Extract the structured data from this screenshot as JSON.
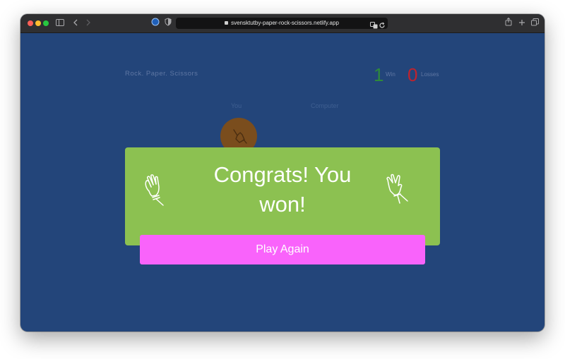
{
  "browser": {
    "url": "svensktutby-paper-rock-scissors.netlify.app",
    "icons": {
      "sidebar": "sidebar-icon",
      "back": "chevron-left-icon",
      "forward": "chevron-right-icon",
      "shield": "shield-icon",
      "translate": "translate-icon",
      "reload": "reload-icon",
      "share": "share-icon",
      "new_tab": "plus-icon",
      "tabs": "tabs-overview-icon"
    }
  },
  "game": {
    "title": "Rock. Paper. Scissors",
    "wins": {
      "value": "1",
      "label": "Win",
      "color": "#2f8a3a"
    },
    "losses": {
      "value": "0",
      "label": "Losses",
      "color": "#c0232d"
    },
    "player_label": "You",
    "computer_label": "Computer"
  },
  "result": {
    "message": "Congrats! You won!",
    "button_label": "Play Again",
    "card_color": "#8cc151",
    "button_color": "#f963fb"
  }
}
